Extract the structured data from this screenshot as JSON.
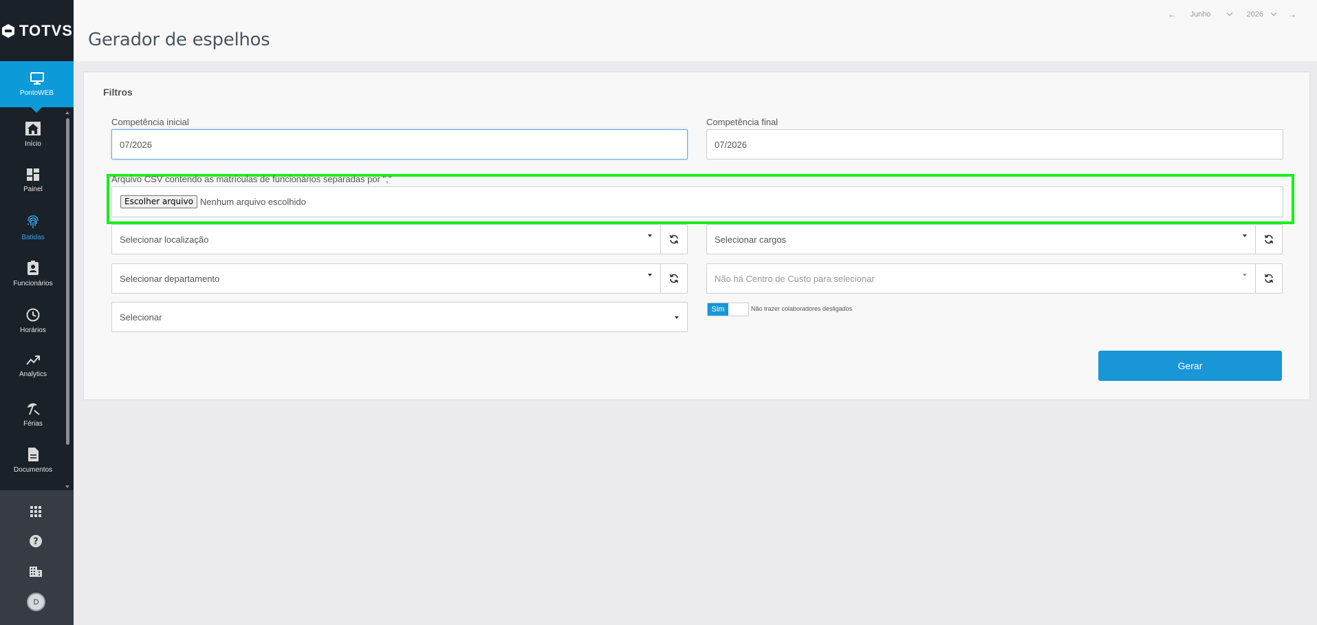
{
  "app": {
    "brand": "TOTVS",
    "active_module": "PontoWEB"
  },
  "sidebar": {
    "items": [
      {
        "label": "Início",
        "icon": "home-icon"
      },
      {
        "label": "Painel",
        "icon": "dashboard-icon"
      },
      {
        "label": "Batidas",
        "icon": "fingerprint-icon"
      },
      {
        "label": "Funcionários",
        "icon": "badge-icon"
      },
      {
        "label": "Horários",
        "icon": "clock-icon"
      },
      {
        "label": "Analytics",
        "icon": "trending-up-icon"
      },
      {
        "label": "Férias",
        "icon": "beach-umbrella-icon"
      },
      {
        "label": "Documentos",
        "icon": "document-icon"
      }
    ],
    "bottom_icons": [
      "apps-grid-icon",
      "help-icon",
      "building-icon"
    ],
    "avatar_initial": "D"
  },
  "header": {
    "title": "Gerador de espelhos",
    "period": {
      "month": "Junho",
      "year": "2026"
    }
  },
  "filters": {
    "title": "Filtros",
    "competencia_inicial": {
      "label": "Competência inicial",
      "value": "07/2026"
    },
    "competencia_final": {
      "label": "Competência final",
      "value": "07/2026"
    },
    "csv": {
      "label": "Arquivo CSV contendo as matrículas de funcionários separadas por \",\"",
      "button": "Escolher arquivo",
      "status": "Nenhum arquivo escolhido"
    },
    "localizacao": {
      "placeholder": "Selecionar localização"
    },
    "cargos": {
      "placeholder": "Selecionar cargos"
    },
    "departamento": {
      "placeholder": "Selecionar departamento"
    },
    "centro_custo": {
      "placeholder": "Não há Centro de Custo para selecionar"
    },
    "generic": {
      "placeholder": "Selecionar"
    },
    "toggle": {
      "on_label": "Sim",
      "label": "Não trazer colaboradores desligados"
    },
    "submit": "Gerar"
  },
  "colors": {
    "accent": "#1996d6",
    "sidebar_bg": "#1b2129",
    "highlight_border": "#18f01a"
  }
}
